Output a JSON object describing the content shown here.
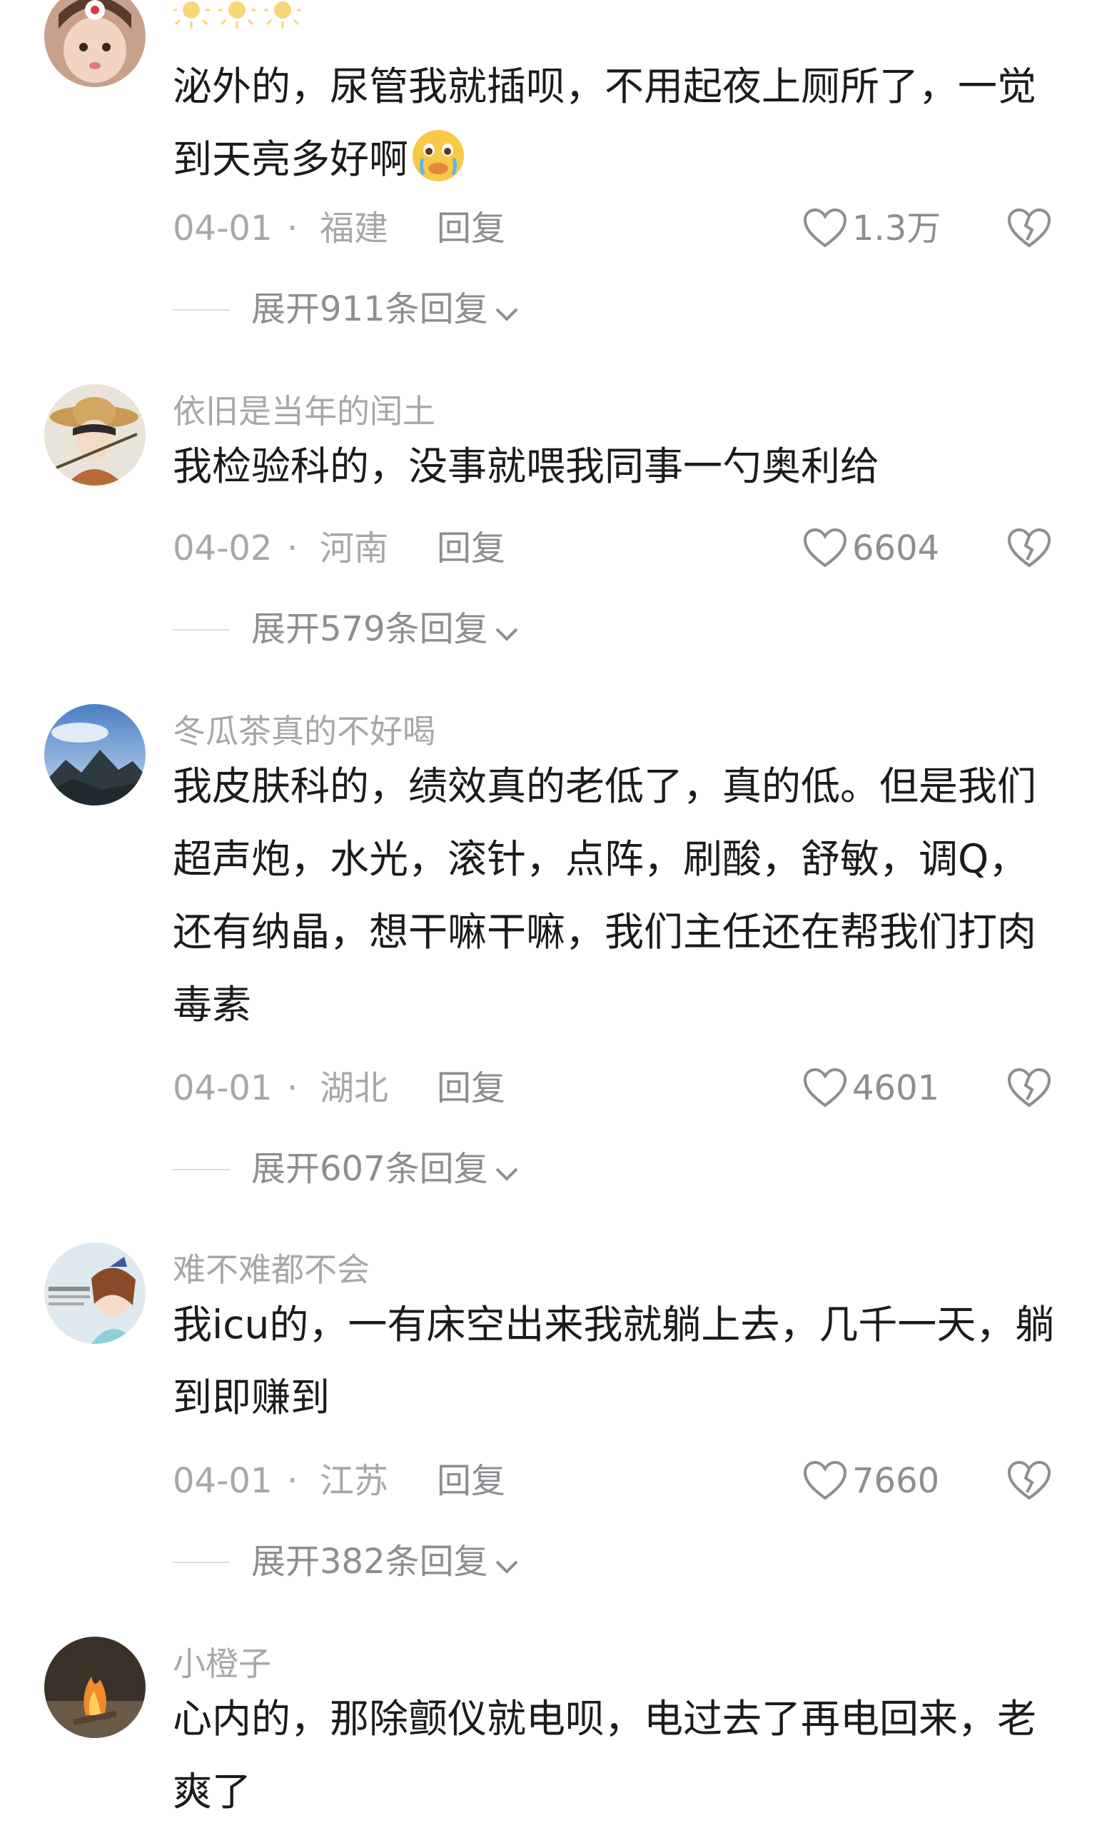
{
  "comments": [
    {
      "username": "",
      "text": "泌外的，尿管我就插呗，不用起夜上厕所了，一觉到天亮多好啊",
      "emoji": "crying-emoji",
      "date": "04-01",
      "region": "福建",
      "reply_label": "回复",
      "likes": "1.3万",
      "expand_label": "展开911条回复"
    },
    {
      "username": "依旧是当年的闰土",
      "text": "我检验科的，没事就喂我同事一勺奥利给",
      "date": "04-02",
      "region": "河南",
      "reply_label": "回复",
      "likes": "6604",
      "expand_label": "展开579条回复"
    },
    {
      "username": "冬瓜茶真的不好喝",
      "text": "我皮肤科的，绩效真的老低了，真的低。但是我们超声炮，水光，滚针，点阵，刷酸，舒敏，调Q，还有纳晶，想干嘛干嘛，我们主任还在帮我们打肉毒素",
      "date": "04-01",
      "region": "湖北",
      "reply_label": "回复",
      "likes": "4601",
      "expand_label": "展开607条回复"
    },
    {
      "username": "难不难都不会",
      "text": "我icu的，一有床空出来我就躺上去，几千一天，躺到即赚到",
      "date": "04-01",
      "region": "江苏",
      "reply_label": "回复",
      "likes": "7660",
      "expand_label": "展开382条回复"
    },
    {
      "username": "小橙子",
      "text": "心内的，那除颤仪就电呗，电过去了再电回来，老爽了"
    }
  ],
  "meta_separator": "·",
  "colors": {
    "secondary_text": "#a7a7ab",
    "primary_text": "#1b1b1b",
    "icon_gray": "#8d8d92"
  }
}
